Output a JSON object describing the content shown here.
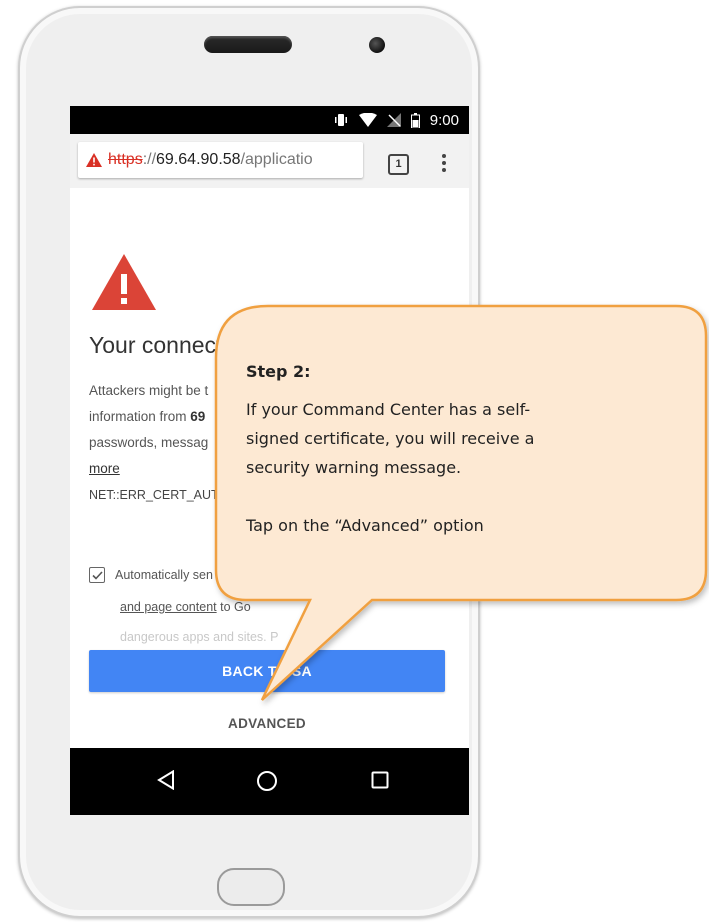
{
  "status_bar": {
    "time": "9:00"
  },
  "browser": {
    "url_scheme": "https",
    "url_separator": "://",
    "url_host": "69.64.90.58",
    "url_path": "/applicatio",
    "tab_count": "1"
  },
  "interstitial": {
    "heading": "Your connect",
    "line1": "Attackers might be t",
    "line2_prefix": "information from ",
    "line2_bold": "69",
    "line3": "passwords, messag",
    "learn_more": "more",
    "error_code": "NET::ERR_CERT_AUTH",
    "checkbox_label": "Automatically sen",
    "checkbox_line2_link": "and page content",
    "checkbox_line2_rest": " to Go",
    "checkbox_line3": "dangerous apps and sites. P",
    "back_button": "BACK TO SA",
    "advanced_button": "ADVANCED"
  },
  "callout": {
    "title": "Step 2:",
    "body": "If your Command Center has a self-\nsigned certificate, you will receive a\nsecurity warning message.\n\nTap on the “Advanced” option"
  },
  "colors": {
    "callout_fill": "#fde9d3",
    "callout_border": "#f0a040",
    "button_blue": "#4285f4",
    "warning_red": "#db4437"
  }
}
